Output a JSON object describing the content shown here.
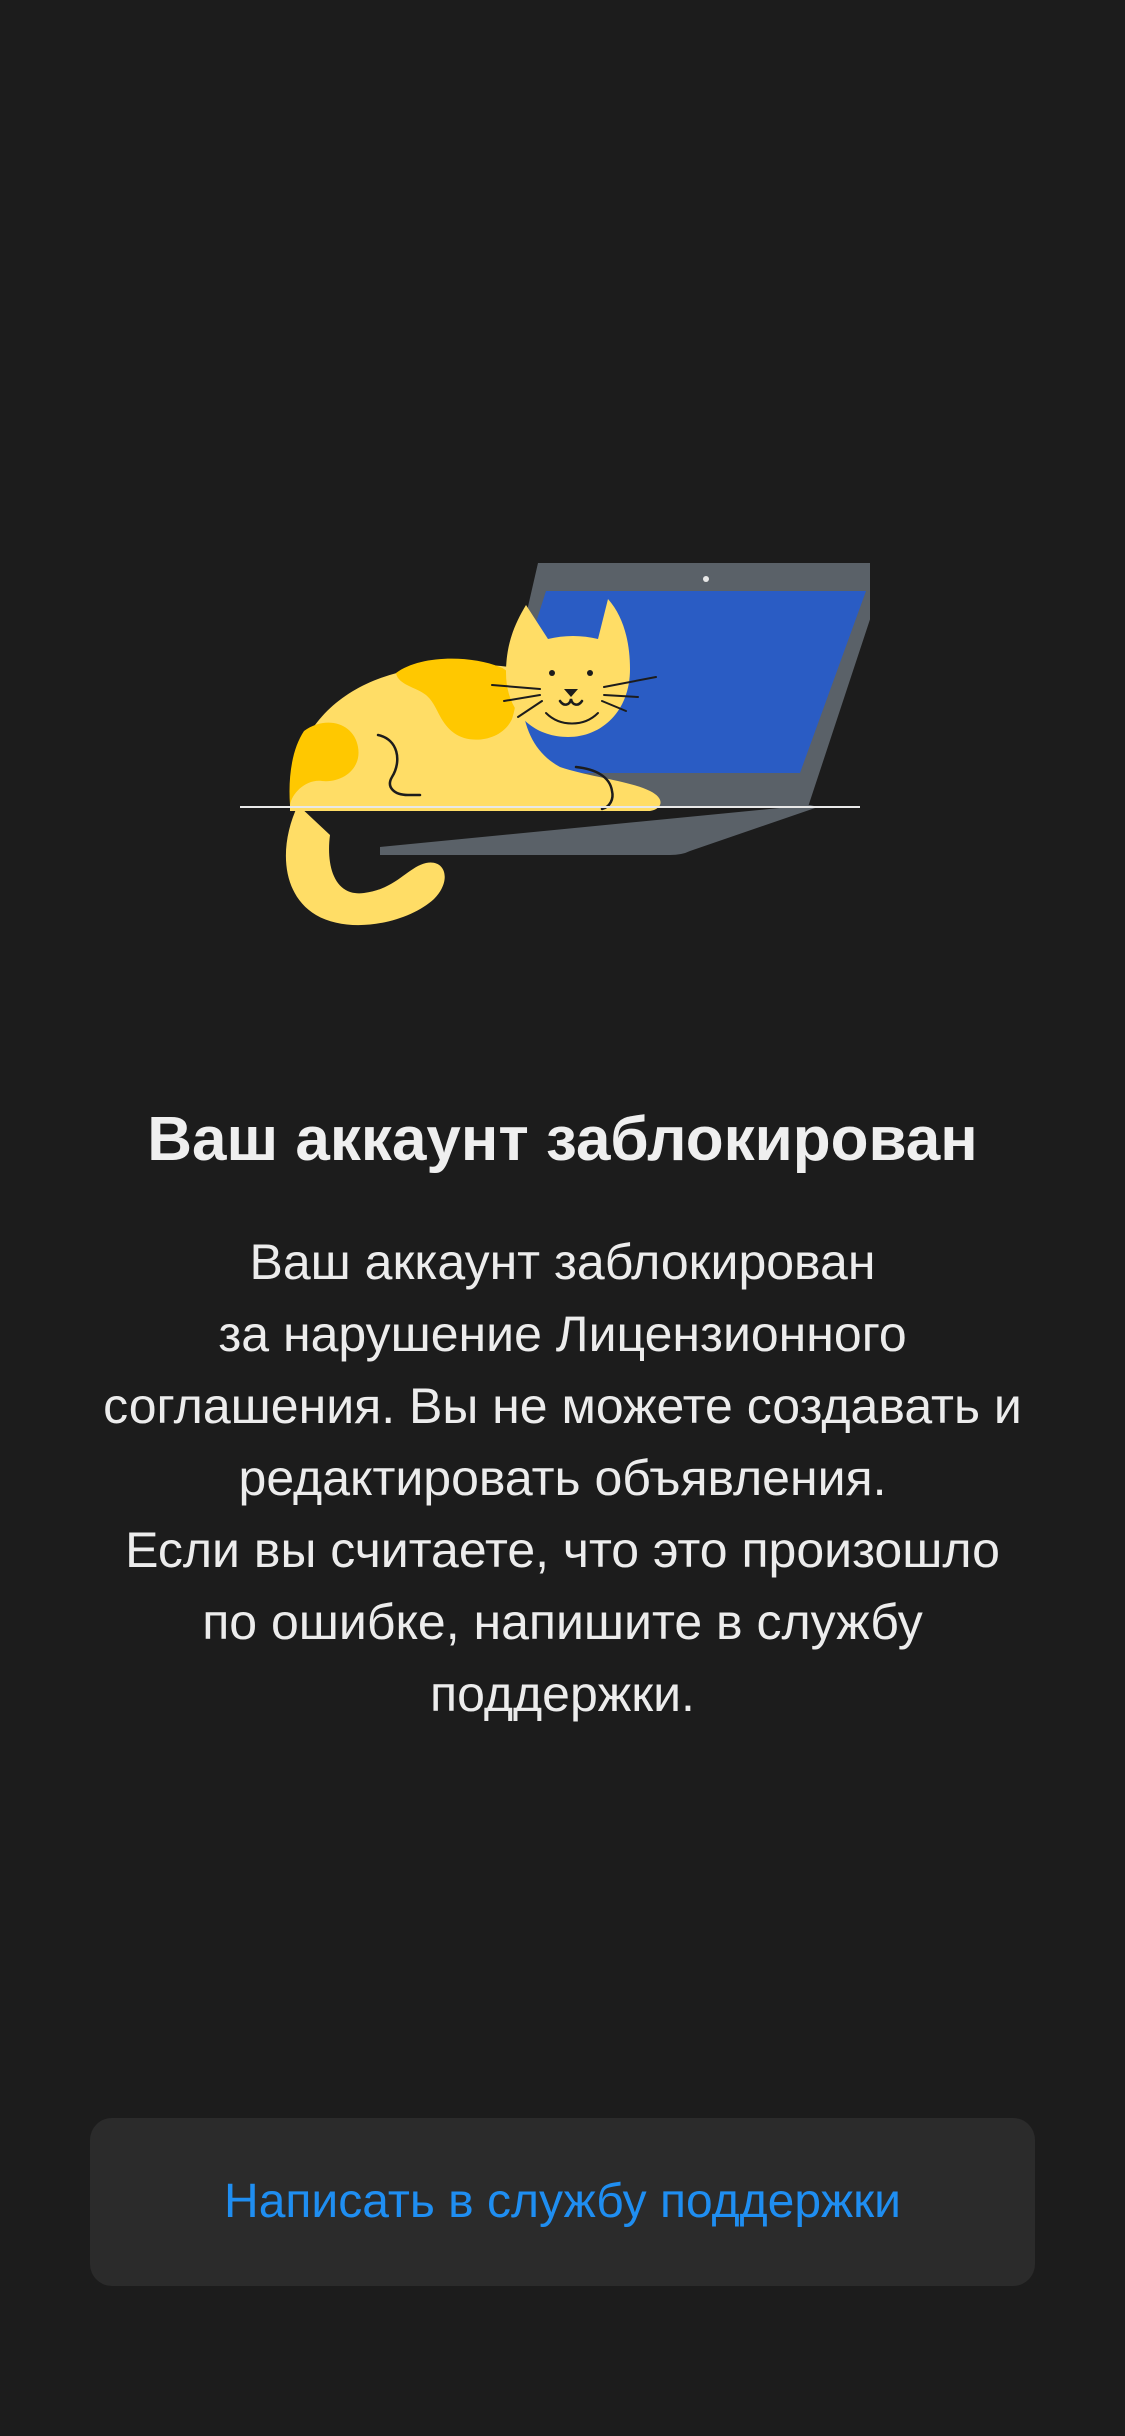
{
  "illustration": {
    "icon": "cat-on-laptop-illustration",
    "colors": {
      "laptop_frame": "#5a6168",
      "laptop_screen": "#2a5cc4",
      "cat_body": "#ffdd66",
      "cat_spots": "#ffc800",
      "outline": "#1c1c1c",
      "floor_line": "#e8e8e8"
    }
  },
  "title": "Ваш аккаунт заблокирован",
  "message_lines": [
    "Ваш аккаунт заблокирован",
    "за нарушение Лицензионного",
    "соглашения. Вы не можете создавать и",
    "редактировать объявления.",
    "Если вы считаете, что это произошло",
    "по ошибке, напишите в службу",
    "поддержки."
  ],
  "support_button_label": "Написать в службу поддержки",
  "colors": {
    "background": "#1c1c1c",
    "button_background": "#2b2b2b",
    "accent": "#1f8ef1",
    "text": "#ececec"
  }
}
